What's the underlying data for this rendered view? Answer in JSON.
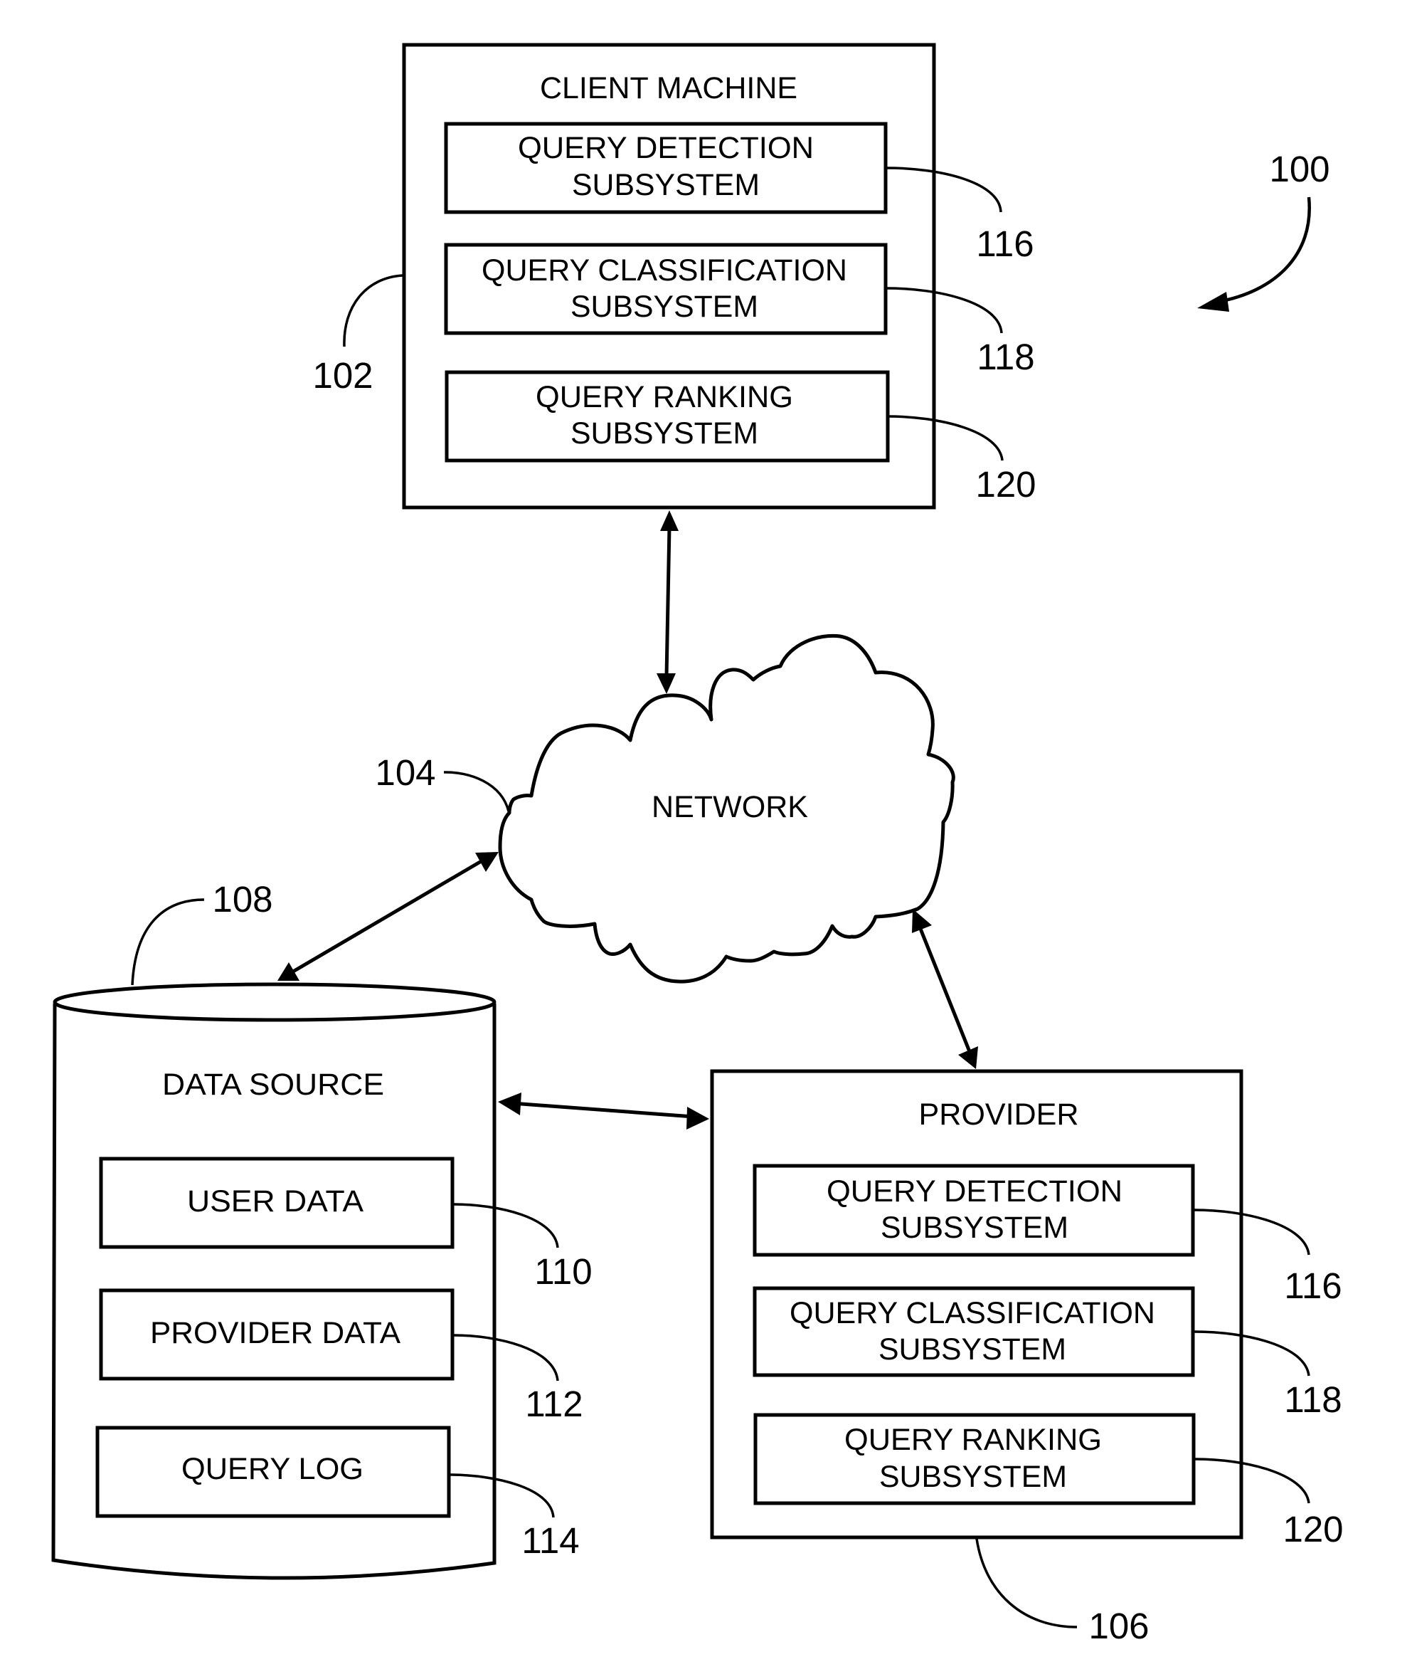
{
  "figure": {
    "reference": "100",
    "colors": {
      "stroke": "#000000",
      "background": "#ffffff"
    }
  },
  "client_machine": {
    "title": "CLIENT MACHINE",
    "reference": "102",
    "subsystems": [
      {
        "line1": "QUERY DETECTION",
        "line2": "SUBSYSTEM",
        "reference": "116"
      },
      {
        "line1": "QUERY CLASSIFICATION",
        "line2": "SUBSYSTEM",
        "reference": "118"
      },
      {
        "line1": "QUERY RANKING",
        "line2": "SUBSYSTEM",
        "reference": "120"
      }
    ]
  },
  "network": {
    "label": "NETWORK",
    "reference": "104"
  },
  "data_source": {
    "title": "DATA SOURCE",
    "reference": "108",
    "stores": [
      {
        "label": "USER DATA",
        "reference": "110"
      },
      {
        "label": "PROVIDER DATA",
        "reference": "112"
      },
      {
        "label": "QUERY LOG",
        "reference": "114"
      }
    ]
  },
  "provider": {
    "title": "PROVIDER",
    "reference": "106",
    "subsystems": [
      {
        "line1": "QUERY DETECTION",
        "line2": "SUBSYSTEM",
        "reference": "116"
      },
      {
        "line1": "QUERY CLASSIFICATION",
        "line2": "SUBSYSTEM",
        "reference": "118"
      },
      {
        "line1": "QUERY RANKING",
        "line2": "SUBSYSTEM",
        "reference": "120"
      }
    ]
  },
  "connections": [
    {
      "from": "CLIENT MACHINE",
      "to": "NETWORK",
      "bidirectional": true
    },
    {
      "from": "NETWORK",
      "to": "DATA SOURCE",
      "bidirectional": true
    },
    {
      "from": "NETWORK",
      "to": "PROVIDER",
      "bidirectional": true
    },
    {
      "from": "DATA SOURCE",
      "to": "PROVIDER",
      "bidirectional": true
    }
  ]
}
